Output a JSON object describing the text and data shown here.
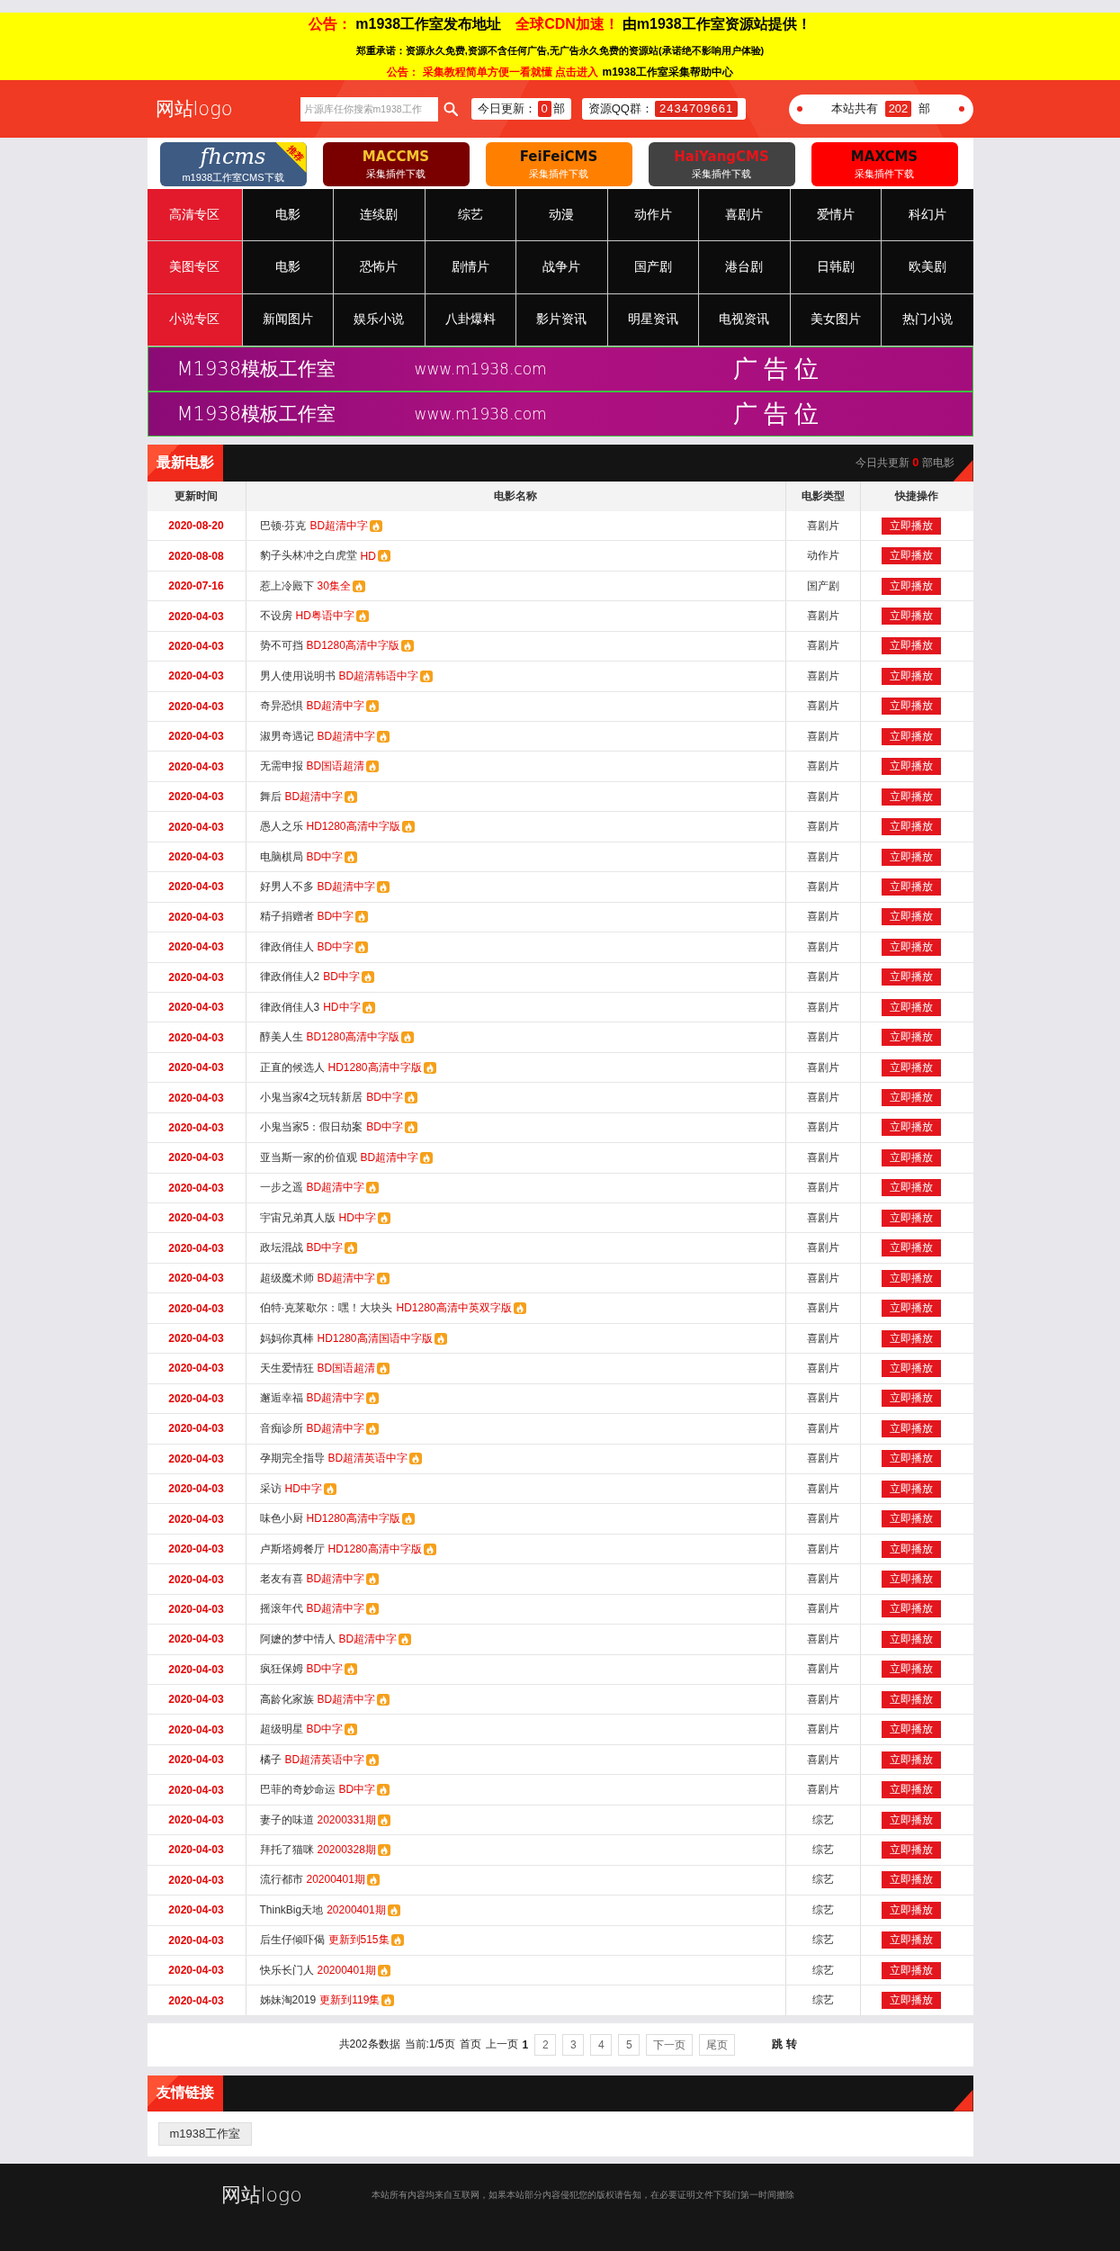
{
  "notice": {
    "lines": [
      {
        "kind": "headline",
        "segments": [
          {
            "text": "公告：",
            "highlight": true
          },
          {
            "text": "m1938工作室发布地址",
            "highlight": false
          },
          {
            "text": "全球CDN加速！",
            "highlight": true
          },
          {
            "text": "由m1938工作室资源站提供！",
            "highlight": false
          }
        ]
      },
      {
        "kind": "note",
        "segments": [
          {
            "text": "郑重承诺：资源永久免费,资源不含任何广告,无广告永久免费的资源站(承诺绝不影响用户体验)",
            "highlight": false
          }
        ]
      },
      {
        "kind": "link",
        "segments": [
          {
            "text": "公告：",
            "highlight": true
          },
          {
            "text": "采集教程简单方便一看就懂 点击进入",
            "highlight": true
          },
          {
            "text": "m1938工作室采集帮助中心",
            "highlight": false
          }
        ]
      }
    ]
  },
  "header": {
    "logo": "网站logo",
    "search": {
      "placeholder": "片源库任你搜索m1938工作"
    },
    "today_update": {
      "label": "今日更新：",
      "count": "0",
      "unit": "部"
    },
    "qq_group": {
      "label": "资源QQ群：",
      "number": "2434709661"
    },
    "site_total": {
      "label": "本站共有",
      "count": "202",
      "unit": "部"
    }
  },
  "cms_links": [
    {
      "kind": "script",
      "title": {
        "text": "fhcms",
        "color": "#ffffff"
      },
      "subtitle": "m1938工作室CMS下载",
      "badge": "推荐",
      "color": "#3e5b83"
    },
    {
      "kind": "caps",
      "title": {
        "text": "MACCMS",
        "color": "#f4c430"
      },
      "subtitle": "采集插件下载",
      "color": "#7a0000"
    },
    {
      "kind": "caps",
      "title": {
        "text": "FeiFeiCMS",
        "color": "#111111"
      },
      "subtitle": "采集插件下载",
      "color": "#ff8000"
    },
    {
      "kind": "caps",
      "title": {
        "text": "HaiYangCMS",
        "color": "#e8141b"
      },
      "subtitle": "采集插件下载",
      "color": "#424242"
    },
    {
      "kind": "caps",
      "title": {
        "text": "MAXCMS",
        "color": "#111111"
      },
      "subtitle": "采集插件下载",
      "color": "#ff0000"
    }
  ],
  "categories": [
    {
      "zone": "高清专区",
      "items": [
        "电影",
        "连续剧",
        "综艺",
        "动漫",
        "动作片",
        "喜剧片",
        "爱情片",
        "科幻片"
      ]
    },
    {
      "zone": "美图专区",
      "items": [
        "电影",
        "恐怖片",
        "剧情片",
        "战争片",
        "国产剧",
        "港台剧",
        "日韩剧",
        "欧美剧"
      ]
    },
    {
      "zone": "小说专区",
      "items": [
        "新闻图片",
        "娱乐小说",
        "八卦爆料",
        "影片资讯",
        "明星资讯",
        "电视资讯",
        "美女图片",
        "热门小说"
      ]
    }
  ],
  "ad_banners": [
    {
      "brand": "M1938模板工作室",
      "url": "www.m1938.com",
      "label": "广告位"
    },
    {
      "brand": "M1938模板工作室",
      "url": "www.m1938.com",
      "label": "广告位"
    }
  ],
  "latest": {
    "title": "最新电影",
    "today_prefix": "今日共更新",
    "today_count": "0",
    "today_suffix": "部电影",
    "columns": [
      "更新时间",
      "电影名称",
      "电影类型",
      "快捷操作"
    ],
    "rows": [
      {
        "date": "2020-08-20",
        "title": "巴顿·芬克",
        "quality": "BD超清中字",
        "genre": "喜剧片",
        "action": "立即播放"
      },
      {
        "date": "2020-08-08",
        "title": "豹子头林冲之白虎堂",
        "quality": "HD",
        "genre": "动作片",
        "action": "立即播放"
      },
      {
        "date": "2020-07-16",
        "title": "惹上冷殿下",
        "quality": "30集全",
        "genre": "国产剧",
        "action": "立即播放"
      },
      {
        "date": "2020-04-03",
        "title": "不设房",
        "quality": "HD粤语中字",
        "genre": "喜剧片",
        "action": "立即播放"
      },
      {
        "date": "2020-04-03",
        "title": "势不可挡",
        "quality": "BD1280高清中字版",
        "genre": "喜剧片",
        "action": "立即播放"
      },
      {
        "date": "2020-04-03",
        "title": "男人使用说明书",
        "quality": "BD超清韩语中字",
        "genre": "喜剧片",
        "action": "立即播放"
      },
      {
        "date": "2020-04-03",
        "title": "奇异恐惧",
        "quality": "BD超清中字",
        "genre": "喜剧片",
        "action": "立即播放"
      },
      {
        "date": "2020-04-03",
        "title": "淑男奇遇记",
        "quality": "BD超清中字",
        "genre": "喜剧片",
        "action": "立即播放"
      },
      {
        "date": "2020-04-03",
        "title": "无需申报",
        "quality": "BD国语超清",
        "genre": "喜剧片",
        "action": "立即播放"
      },
      {
        "date": "2020-04-03",
        "title": "舞后",
        "quality": "BD超清中字",
        "genre": "喜剧片",
        "action": "立即播放"
      },
      {
        "date": "2020-04-03",
        "title": "愚人之乐",
        "quality": "HD1280高清中字版",
        "genre": "喜剧片",
        "action": "立即播放"
      },
      {
        "date": "2020-04-03",
        "title": "电脑棋局",
        "quality": "BD中字",
        "genre": "喜剧片",
        "action": "立即播放"
      },
      {
        "date": "2020-04-03",
        "title": "好男人不多",
        "quality": "BD超清中字",
        "genre": "喜剧片",
        "action": "立即播放"
      },
      {
        "date": "2020-04-03",
        "title": "精子捐赠者",
        "quality": "BD中字",
        "genre": "喜剧片",
        "action": "立即播放"
      },
      {
        "date": "2020-04-03",
        "title": "律政俏佳人",
        "quality": "BD中字",
        "genre": "喜剧片",
        "action": "立即播放"
      },
      {
        "date": "2020-04-03",
        "title": "律政俏佳人2",
        "quality": "BD中字",
        "genre": "喜剧片",
        "action": "立即播放"
      },
      {
        "date": "2020-04-03",
        "title": "律政俏佳人3",
        "quality": "HD中字",
        "genre": "喜剧片",
        "action": "立即播放"
      },
      {
        "date": "2020-04-03",
        "title": "醇美人生",
        "quality": "BD1280高清中字版",
        "genre": "喜剧片",
        "action": "立即播放"
      },
      {
        "date": "2020-04-03",
        "title": "正直的候选人",
        "quality": "HD1280高清中字版",
        "genre": "喜剧片",
        "action": "立即播放"
      },
      {
        "date": "2020-04-03",
        "title": "小鬼当家4之玩转新居",
        "quality": "BD中字",
        "genre": "喜剧片",
        "action": "立即播放"
      },
      {
        "date": "2020-04-03",
        "title": "小鬼当家5：假日劫案",
        "quality": "BD中字",
        "genre": "喜剧片",
        "action": "立即播放"
      },
      {
        "date": "2020-04-03",
        "title": "亚当斯一家的价值观",
        "quality": "BD超清中字",
        "genre": "喜剧片",
        "action": "立即播放"
      },
      {
        "date": "2020-04-03",
        "title": "一步之遥",
        "quality": "BD超清中字",
        "genre": "喜剧片",
        "action": "立即播放"
      },
      {
        "date": "2020-04-03",
        "title": "宇宙兄弟真人版",
        "quality": "HD中字",
        "genre": "喜剧片",
        "action": "立即播放"
      },
      {
        "date": "2020-04-03",
        "title": "政坛混战",
        "quality": "BD中字",
        "genre": "喜剧片",
        "action": "立即播放"
      },
      {
        "date": "2020-04-03",
        "title": "超级魔术师",
        "quality": "BD超清中字",
        "genre": "喜剧片",
        "action": "立即播放"
      },
      {
        "date": "2020-04-03",
        "title": "伯特·克莱歇尔：嘿！大块头",
        "quality": "HD1280高清中英双字版",
        "genre": "喜剧片",
        "action": "立即播放"
      },
      {
        "date": "2020-04-03",
        "title": "妈妈你真棒",
        "quality": "HD1280高清国语中字版",
        "genre": "喜剧片",
        "action": "立即播放"
      },
      {
        "date": "2020-04-03",
        "title": "天生爱情狂",
        "quality": "BD国语超清",
        "genre": "喜剧片",
        "action": "立即播放"
      },
      {
        "date": "2020-04-03",
        "title": "邂逅幸福",
        "quality": "BD超清中字",
        "genre": "喜剧片",
        "action": "立即播放"
      },
      {
        "date": "2020-04-03",
        "title": "音痴诊所",
        "quality": "BD超清中字",
        "genre": "喜剧片",
        "action": "立即播放"
      },
      {
        "date": "2020-04-03",
        "title": "孕期完全指导",
        "quality": "BD超清英语中字",
        "genre": "喜剧片",
        "action": "立即播放"
      },
      {
        "date": "2020-04-03",
        "title": "采访",
        "quality": "HD中字",
        "genre": "喜剧片",
        "action": "立即播放"
      },
      {
        "date": "2020-04-03",
        "title": "味色小厨",
        "quality": "HD1280高清中字版",
        "genre": "喜剧片",
        "action": "立即播放"
      },
      {
        "date": "2020-04-03",
        "title": "卢斯塔姆餐厅",
        "quality": "HD1280高清中字版",
        "genre": "喜剧片",
        "action": "立即播放"
      },
      {
        "date": "2020-04-03",
        "title": "老友有喜",
        "quality": "BD超清中字",
        "genre": "喜剧片",
        "action": "立即播放"
      },
      {
        "date": "2020-04-03",
        "title": "摇滚年代",
        "quality": "BD超清中字",
        "genre": "喜剧片",
        "action": "立即播放"
      },
      {
        "date": "2020-04-03",
        "title": "阿嬷的梦中情人",
        "quality": "BD超清中字",
        "genre": "喜剧片",
        "action": "立即播放"
      },
      {
        "date": "2020-04-03",
        "title": "疯狂保姆",
        "quality": "BD中字",
        "genre": "喜剧片",
        "action": "立即播放"
      },
      {
        "date": "2020-04-03",
        "title": "高龄化家族",
        "quality": "BD超清中字",
        "genre": "喜剧片",
        "action": "立即播放"
      },
      {
        "date": "2020-04-03",
        "title": "超级明星",
        "quality": "BD中字",
        "genre": "喜剧片",
        "action": "立即播放"
      },
      {
        "date": "2020-04-03",
        "title": "橘子",
        "quality": "BD超清英语中字",
        "genre": "喜剧片",
        "action": "立即播放"
      },
      {
        "date": "2020-04-03",
        "title": "巴菲的奇妙命运",
        "quality": "BD中字",
        "genre": "喜剧片",
        "action": "立即播放"
      },
      {
        "date": "2020-04-03",
        "title": "妻子的味道",
        "quality": "20200331期",
        "genre": "综艺",
        "action": "立即播放"
      },
      {
        "date": "2020-04-03",
        "title": "拜托了猫咪",
        "quality": "20200328期",
        "genre": "综艺",
        "action": "立即播放"
      },
      {
        "date": "2020-04-03",
        "title": "流行都市",
        "quality": "20200401期",
        "genre": "综艺",
        "action": "立即播放"
      },
      {
        "date": "2020-04-03",
        "title": "ThinkBig天地",
        "quality": "20200401期",
        "genre": "综艺",
        "action": "立即播放"
      },
      {
        "date": "2020-04-03",
        "title": "后生仔倾吓偈",
        "quality": "更新到515集",
        "genre": "综艺",
        "action": "立即播放"
      },
      {
        "date": "2020-04-03",
        "title": "快乐长门人",
        "quality": "20200401期",
        "genre": "综艺",
        "action": "立即播放"
      },
      {
        "date": "2020-04-03",
        "title": "姊妹淘2019",
        "quality": "更新到119集",
        "genre": "综艺",
        "action": "立即播放"
      }
    ]
  },
  "pagination": {
    "total": "共202条数据",
    "current": "当前:1/5页",
    "first": {
      "label": "首页",
      "disabled": true
    },
    "prev": {
      "label": "上一页",
      "disabled": true
    },
    "pages": [
      {
        "label": "1",
        "selected": true
      },
      {
        "label": "2",
        "selected": false
      },
      {
        "label": "3",
        "selected": false
      },
      {
        "label": "4",
        "selected": false
      },
      {
        "label": "5",
        "selected": false
      }
    ],
    "next": {
      "label": "下一页",
      "disabled": false
    },
    "last": {
      "label": "尾页",
      "disabled": false
    },
    "jump": "跳 转"
  },
  "friend_links": {
    "title": "友情链接",
    "links": [
      "m1938工作室"
    ]
  },
  "footer": {
    "logo": "网站logo",
    "notice": "本站所有内容均来自互联网，如果本站部分内容侵犯您的版权请告知，在必要证明文件下我们第一时间撤除"
  }
}
